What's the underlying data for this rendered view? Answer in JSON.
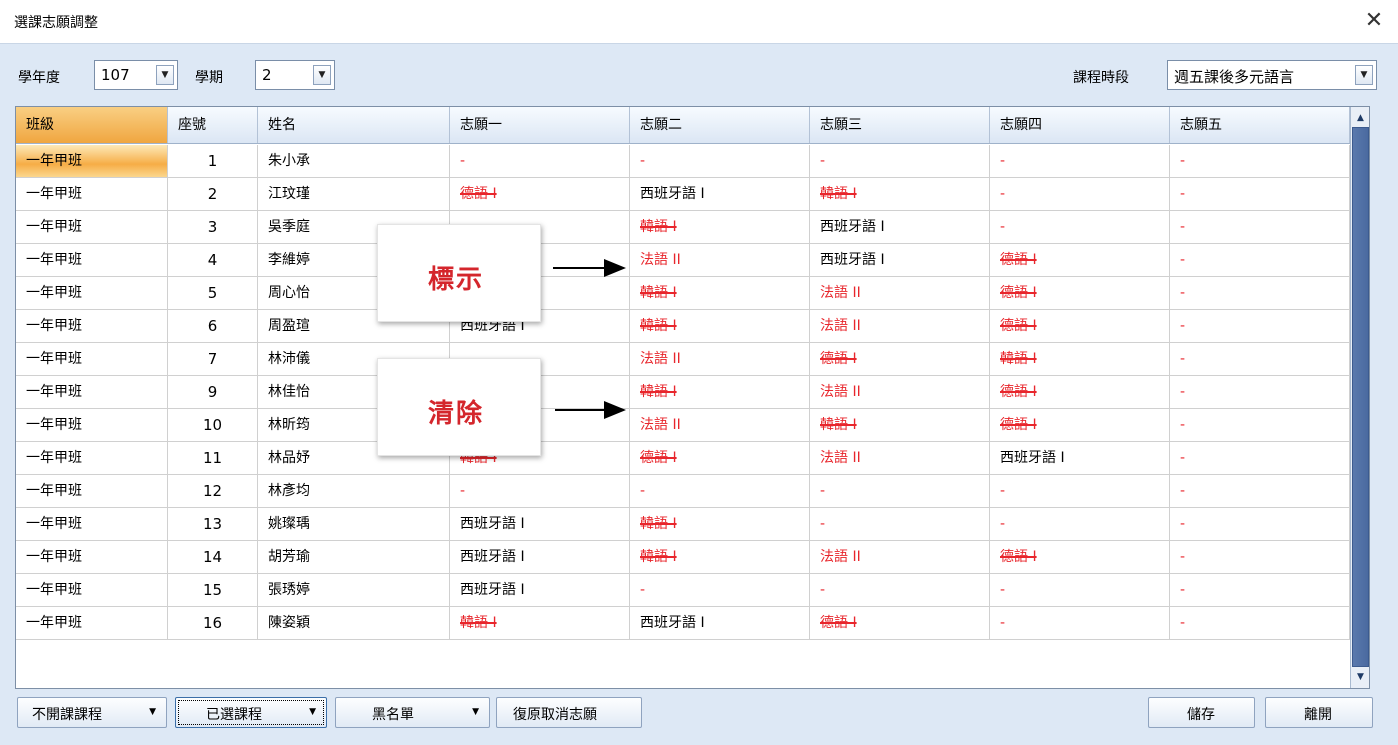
{
  "window": {
    "title": "選課志願調整",
    "close_label": "✕"
  },
  "filters": {
    "year_label": "學年度",
    "year_value": "107",
    "semester_label": "學期",
    "semester_value": "2",
    "period_label": "課程時段",
    "period_value": "週五課後多元語言"
  },
  "grid": {
    "headers": [
      "班級",
      "座號",
      "姓名",
      "志願一",
      "志願二",
      "志願三",
      "志願四",
      "志願五"
    ],
    "rows": [
      {
        "cls": "一年甲班",
        "seat": "1",
        "name": "朱小承",
        "c1": "-",
        "c2": "-",
        "c3": "-",
        "c4": "-",
        "c5": "-"
      },
      {
        "cls": "一年甲班",
        "seat": "2",
        "name": "江玟瑾",
        "c1": "德語 I",
        "c2": "西班牙語 I",
        "c3": "韓語 I",
        "c4": "-",
        "c5": "-"
      },
      {
        "cls": "一年甲班",
        "seat": "3",
        "name": "吳季庭",
        "c1": "",
        "c2": "韓語 I",
        "c3": "西班牙語 I",
        "c4": "-",
        "c5": "-"
      },
      {
        "cls": "一年甲班",
        "seat": "4",
        "name": "李維婷",
        "c1": "",
        "c2": "法語 II",
        "c3": "西班牙語 I",
        "c4": "德語 I",
        "c5": "-"
      },
      {
        "cls": "一年甲班",
        "seat": "5",
        "name": "周心怡",
        "c1": "",
        "c2": "韓語 I",
        "c3": "法語 II",
        "c4": "德語 I",
        "c5": "-"
      },
      {
        "cls": "一年甲班",
        "seat": "6",
        "name": "周盈瑄",
        "c1": "西班牙語 I",
        "c2": "韓語 I",
        "c3": "法語 II",
        "c4": "德語 I",
        "c5": "-"
      },
      {
        "cls": "一年甲班",
        "seat": "7",
        "name": "林沛儀",
        "c1": "",
        "c2": "法語 II",
        "c3": "德語 I",
        "c4": "韓語 I",
        "c5": "-"
      },
      {
        "cls": "一年甲班",
        "seat": "9",
        "name": "林佳怡",
        "c1": "",
        "c2": "韓語 I",
        "c3": "法語 II",
        "c4": "德語 I",
        "c5": "-"
      },
      {
        "cls": "一年甲班",
        "seat": "10",
        "name": "林昕筠",
        "c1": "",
        "c2": "法語 II",
        "c3": "韓語 I",
        "c4": "德語 I",
        "c5": "-"
      },
      {
        "cls": "一年甲班",
        "seat": "11",
        "name": "林品妤",
        "c1": "韓語 I",
        "c2": "德語 I",
        "c3": "法語 II",
        "c4": "西班牙語 I",
        "c5": "-"
      },
      {
        "cls": "一年甲班",
        "seat": "12",
        "name": "林彥均",
        "c1": "-",
        "c2": "-",
        "c3": "-",
        "c4": "-",
        "c5": "-"
      },
      {
        "cls": "一年甲班",
        "seat": "13",
        "name": "姚璨瑀",
        "c1": "西班牙語 I",
        "c2": "韓語 I",
        "c3": "-",
        "c4": "-",
        "c5": "-"
      },
      {
        "cls": "一年甲班",
        "seat": "14",
        "name": "胡芳瑜",
        "c1": "西班牙語 I",
        "c2": "韓語 I",
        "c3": "法語 II",
        "c4": "德語 I",
        "c5": "-"
      },
      {
        "cls": "一年甲班",
        "seat": "15",
        "name": "張琇婷",
        "c1": "西班牙語 I",
        "c2": "-",
        "c3": "-",
        "c4": "-",
        "c5": "-"
      },
      {
        "cls": "一年甲班",
        "seat": "16",
        "name": "陳姿穎",
        "c1": "韓語 I",
        "c2": "西班牙語 I",
        "c3": "德語 I",
        "c4": "-",
        "c5": "-"
      }
    ]
  },
  "callouts": {
    "mark_label": "標示",
    "clear_label": "清除"
  },
  "buttons": {
    "not_open": "不開課課程",
    "selected": "已選課程",
    "blacklist": "黑名單",
    "restore": "復原取消志願",
    "save": "儲存",
    "leave": "離開"
  }
}
